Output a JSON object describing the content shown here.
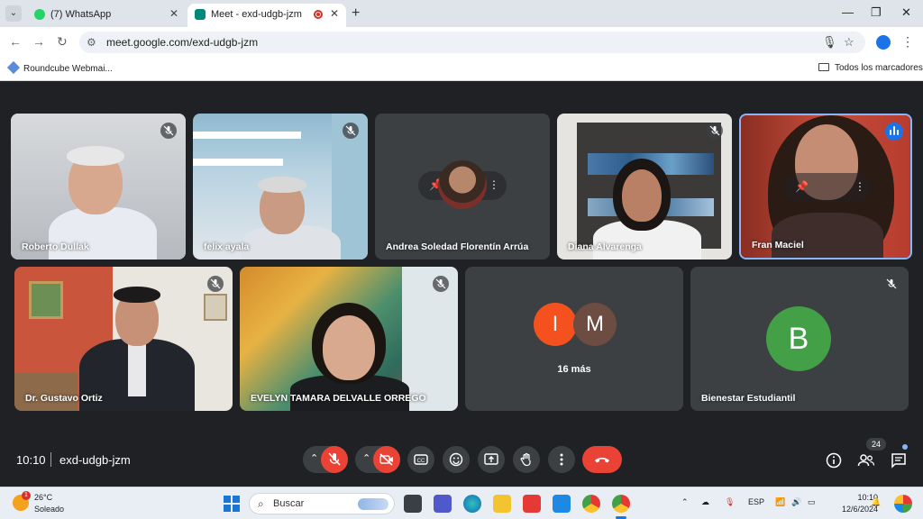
{
  "browser": {
    "tabs": [
      {
        "label": "(7) WhatsApp",
        "active": false,
        "favicon": "whatsapp-icon",
        "color": "#25d366"
      },
      {
        "label": "Meet - exd-udgb-jzm",
        "active": true,
        "favicon": "meet-icon",
        "color": "#00897b"
      }
    ],
    "url": "meet.google.com/exd-udgb-jzm",
    "bookmarks": [
      {
        "label": "Roundcube Webmai..."
      },
      {
        "label": "Todos los marcadores"
      }
    ]
  },
  "meet": {
    "participants_row1": [
      {
        "name": "Roberto Dullak",
        "muted": true
      },
      {
        "name": "felix ayala",
        "muted": true
      },
      {
        "name": "Andrea Soledad Florentín Arrúa",
        "muted": false
      },
      {
        "name": "Diana Alvarenga",
        "muted": true
      },
      {
        "name": "Fran Maciel",
        "speaking": true
      }
    ],
    "participants_row2": [
      {
        "name": "Dr. Gustavo Ortiz",
        "muted": true
      },
      {
        "name": "EVELYN TAMARA DELVALLE ORREGO",
        "muted": true
      },
      {
        "name": "",
        "others_label": "16 más",
        "avatars": [
          {
            "letter": "I",
            "color": "#f4511e"
          },
          {
            "letter": "M",
            "color": "#6d4c41"
          }
        ]
      },
      {
        "name": "Bienestar Estudiantil",
        "muted": true,
        "avatar_letter": "B",
        "avatar_color": "#43a047"
      }
    ],
    "time": "10:10",
    "meeting_code": "exd-udgb-jzm",
    "participant_count": "24",
    "colors": {
      "hangup": "#ea4335",
      "speaking": "#1a73e8",
      "tile": "#3c4043",
      "background": "#202124"
    }
  },
  "taskbar": {
    "weather": {
      "temp": "26°C",
      "condition": "Soleado",
      "alert_count": "1"
    },
    "search_placeholder": "Buscar",
    "language": "ESP",
    "time": "10:10",
    "date": "12/6/2024"
  }
}
